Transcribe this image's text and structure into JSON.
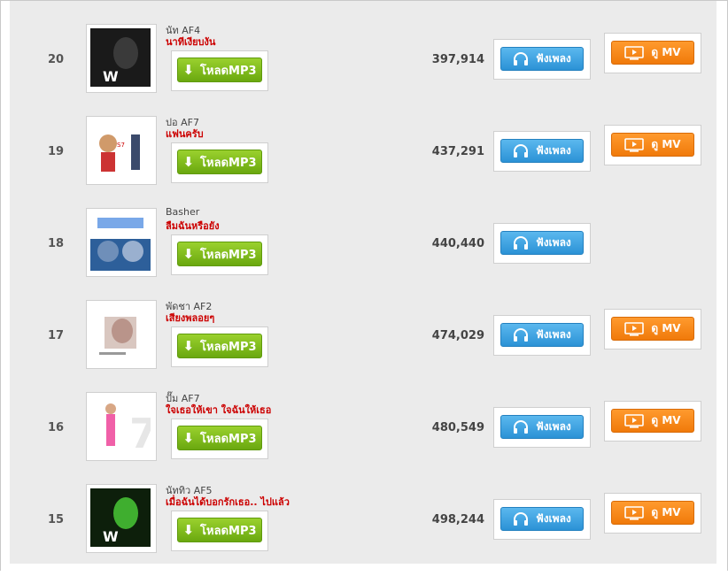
{
  "labels": {
    "download": "โหลดMP3",
    "listen": "ฟังเพลง",
    "watch_mv": "ดู MV"
  },
  "rows": [
    {
      "rank": "20",
      "artist": "นัท AF4",
      "song": "นาทีเงียบงัน",
      "plays": "397,914",
      "has_mv": true,
      "cover": "dark-w"
    },
    {
      "rank": "19",
      "artist": "ปอ AF7",
      "song": "แฟนครับ",
      "plays": "437,291",
      "has_mv": true,
      "cover": "light"
    },
    {
      "rank": "18",
      "artist": "Basher",
      "song": "ลืมฉันหรือยัง",
      "plays": "440,440",
      "has_mv": false,
      "cover": "blue"
    },
    {
      "rank": "17",
      "artist": "พัดชา AF2",
      "song": "เสียงพลอยๆ",
      "plays": "474,029",
      "has_mv": true,
      "cover": "white-portrait"
    },
    {
      "rank": "16",
      "artist": "ปั๊ม AF7",
      "song": "ใจเธอให้เขา ใจฉันให้เธอ",
      "plays": "480,549",
      "has_mv": true,
      "cover": "light-pink"
    },
    {
      "rank": "15",
      "artist": "นัททิว AF5",
      "song": "เมื่อฉันได้บอกรักเธอ.. ไปแล้ว",
      "plays": "498,244",
      "has_mv": true,
      "cover": "green-w"
    }
  ],
  "colors": {
    "download_green": "#7dbd1e",
    "listen_blue": "#3aa3e3",
    "mv_orange": "#f7880f",
    "song_red": "#cc0000"
  },
  "icons": {
    "download": "download-arrow-icon",
    "listen": "headphones-icon",
    "mv": "video-screen-icon"
  }
}
